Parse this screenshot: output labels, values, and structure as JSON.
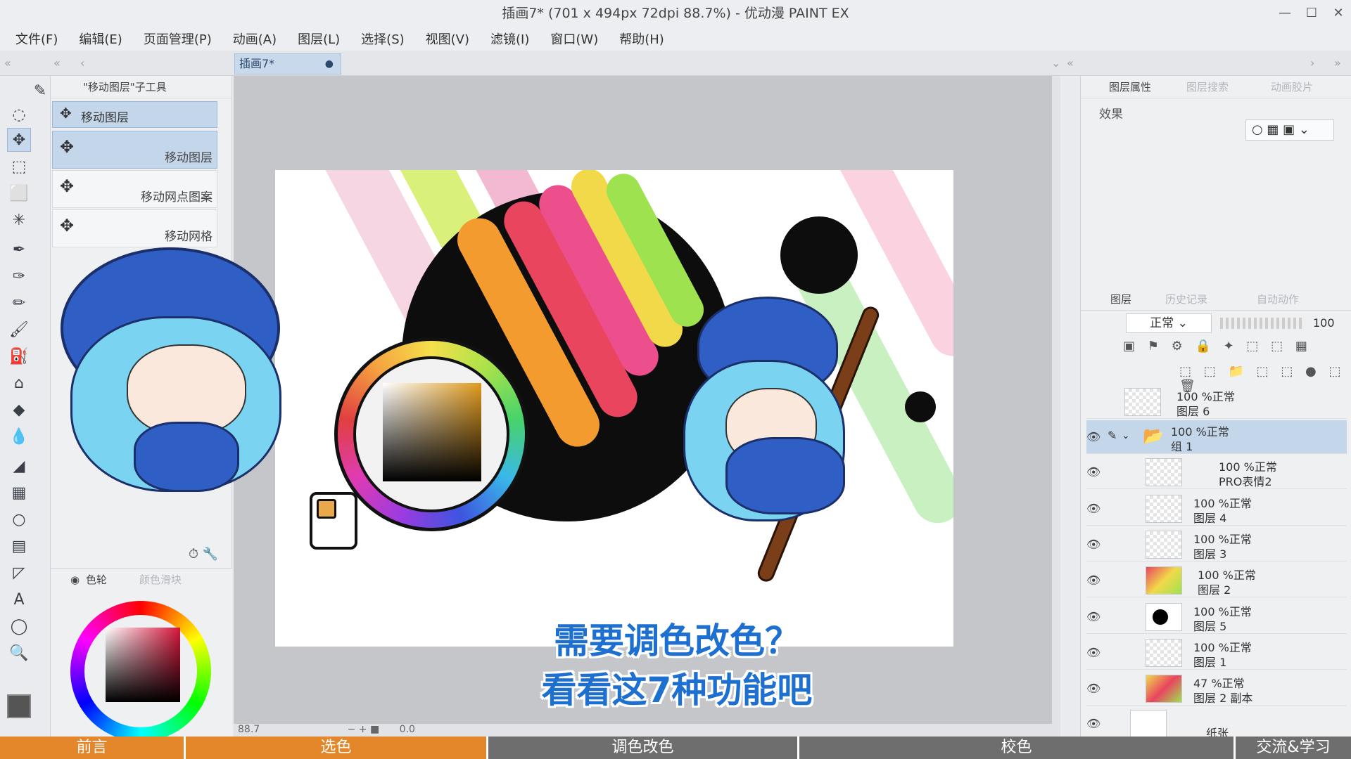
{
  "window": {
    "title": "插画7* (701 x 494px 72dpi 88.7%) - 优动漫 PAINT EX",
    "controls": [
      "—",
      "☐",
      "✕"
    ]
  },
  "menu": [
    "文件(F)",
    "编辑(E)",
    "页面管理(P)",
    "动画(A)",
    "图层(L)",
    "选择(S)",
    "视图(V)",
    "滤镜(I)",
    "窗口(W)",
    "帮助(H)"
  ],
  "canvas_tab": {
    "label": "插画7*",
    "dot": "●"
  },
  "sub_tool": {
    "header": "\"移动图层\"子工具",
    "group_label": "移动图层",
    "items": [
      {
        "label": "移动图层"
      },
      {
        "label": "移动网点图案"
      },
      {
        "label": "移动网格"
      }
    ]
  },
  "color_panel": {
    "tab_wheel": "色轮",
    "tab_other": "颜色滑块"
  },
  "right_top": {
    "tabs": [
      "图层属性",
      "图层搜索",
      "动画胶片"
    ],
    "effect_label": "效果"
  },
  "layer_panel": {
    "tabs": [
      "图层",
      "历史记录",
      "自动动作"
    ],
    "blend_mode": "正常",
    "opacity": "100",
    "layers": [
      {
        "line1": "100 %正常",
        "line2": "图层 6",
        "visible": false
      },
      {
        "line1": "100 %正常",
        "line2": "组 1",
        "visible": true,
        "selected": true
      },
      {
        "line1": "100 %正常",
        "line2": "PRO表情2",
        "visible": true
      },
      {
        "line1": "100 %正常",
        "line2": "图层 4",
        "visible": true
      },
      {
        "line1": "100 %正常",
        "line2": "图层 3",
        "visible": true
      },
      {
        "line1": "100 %正常",
        "line2": "图层 2",
        "visible": true
      },
      {
        "line1": "100 %正常",
        "line2": "图层 5",
        "visible": true
      },
      {
        "line1": "100 %正常",
        "line2": "图层 1",
        "visible": true
      },
      {
        "line1": "47 %正常",
        "line2": "图层 2 副本",
        "visible": true
      },
      {
        "line1": "",
        "line2": "纸张",
        "visible": true
      }
    ]
  },
  "subtitles": [
    "需要调色改色？",
    "看看这7种功能吧"
  ],
  "status": {
    "zoom": "88.7",
    "angle": "0.0"
  },
  "chapters": [
    {
      "label": "前言",
      "done": true
    },
    {
      "label": "选色",
      "done": true
    },
    {
      "label": "调色改色",
      "done": false
    },
    {
      "label": "校色",
      "done": false
    },
    {
      "label": "交流&学习",
      "done": false
    }
  ]
}
